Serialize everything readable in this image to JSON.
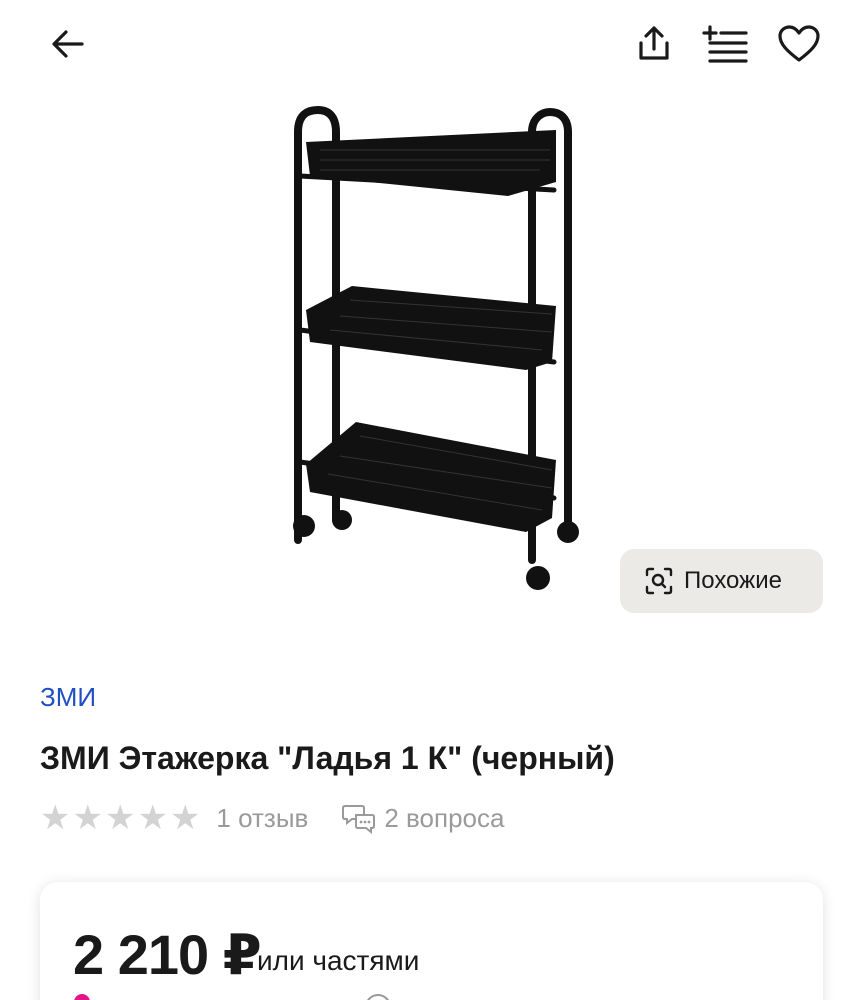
{
  "header": {
    "back_icon": "arrow-left-icon",
    "share_icon": "share-icon",
    "compare_icon": "add-to-list-icon",
    "favorite_icon": "heart-icon"
  },
  "gallery": {
    "image": "metal-rolling-shelf-cart-black-3-baskets",
    "similar_label": "Похожие",
    "similar_icon": "image-search-icon"
  },
  "product": {
    "brand": "ЗМИ",
    "title": "ЗМИ Этажерка \"Ладья 1 К\" (черный)",
    "rating": 0,
    "rating_max": 5,
    "reviews_label": "1 отзыв",
    "questions_label": "2 вопроса",
    "questions_icon": "chat-bubbles-icon"
  },
  "price_card": {
    "price": "2 210 ₽",
    "installments_label": "или частями"
  },
  "colors": {
    "link": "#1f4fc5",
    "muted": "#9a9a9a",
    "button_bg": "#ebeae7",
    "star_inactive": "#d3d3d3",
    "accent_pink": "#e4148a"
  }
}
